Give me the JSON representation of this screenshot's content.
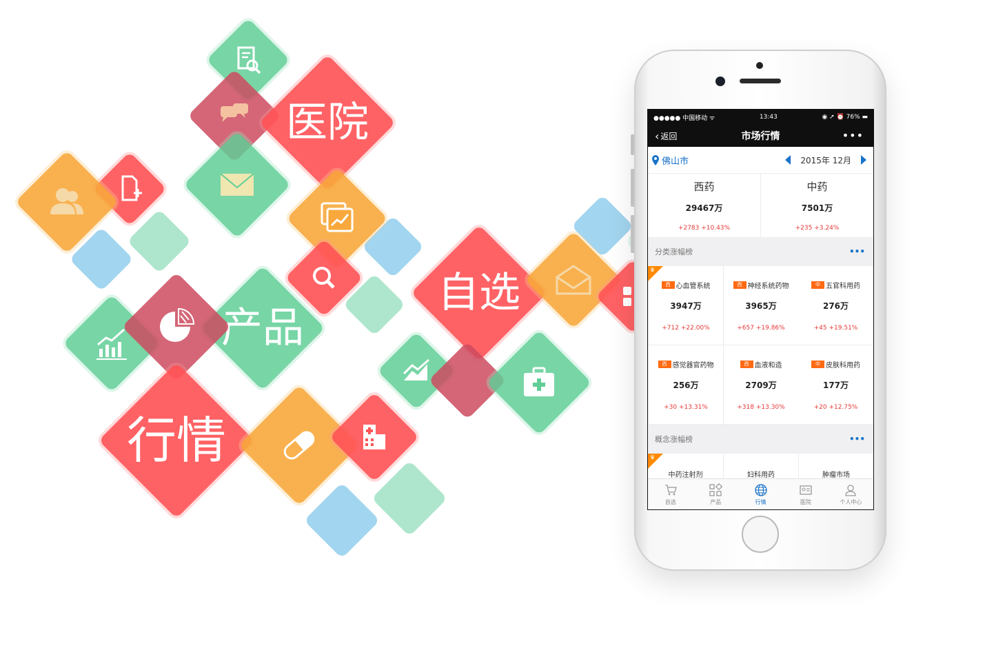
{
  "tiles": {
    "hospital": "医院",
    "product": "产品",
    "favorites": "自选",
    "market": "行情"
  },
  "statusbar": {
    "carrier": "●●●●● 中国移动 ᯤ",
    "time": "13:43",
    "battery": "◉ ➚ ⏰ 76% ▬"
  },
  "navbar": {
    "back_label": "返回",
    "title": "市场行情",
    "more": "•••"
  },
  "citybar": {
    "city": "佛山市",
    "date": "2015年 12月"
  },
  "summary": [
    {
      "name": "西药",
      "value": "29467万",
      "change": "+2783  +10.43%"
    },
    {
      "name": "中药",
      "value": "7501万",
      "change": "+235  +3.24%"
    }
  ],
  "category_section": {
    "title": "分类涨幅榜",
    "more": "•••"
  },
  "category_items": [
    {
      "tag": "西",
      "name": "心血管系统",
      "value": "3947万",
      "change": "+712  +22.00%"
    },
    {
      "tag": "西",
      "name": "神经系统药物",
      "value": "3965万",
      "change": "+657  +19.86%"
    },
    {
      "tag": "中",
      "name": "五官科用药",
      "value": "276万",
      "change": "+45  +19.51%"
    },
    {
      "tag": "西",
      "name": "感觉器官药物",
      "value": "256万",
      "change": "+30  +13.31%"
    },
    {
      "tag": "西",
      "name": "血液和造",
      "value": "2709万",
      "change": "+318  +13.30%"
    },
    {
      "tag": "中",
      "name": "皮肤科用药",
      "value": "177万",
      "change": "+20  +12.75%"
    }
  ],
  "concept_section": {
    "title": "概念涨幅榜",
    "more": "•••"
  },
  "concept_items": [
    {
      "name": "中药注射剂"
    },
    {
      "name": "妇科用药"
    },
    {
      "name": "肿瘤市场"
    }
  ],
  "tabbar": [
    {
      "label": "自选",
      "icon": "cart-icon"
    },
    {
      "label": "产品",
      "icon": "grid-icon"
    },
    {
      "label": "行情",
      "icon": "globe-icon",
      "active": true
    },
    {
      "label": "医院",
      "icon": "id-card-icon"
    },
    {
      "label": "个人中心",
      "icon": "user-icon"
    }
  ],
  "colors": {
    "red": "#ff5558",
    "green": "#60ce96",
    "orange": "#f8a83c",
    "blue": "#92ceec",
    "accent": "#1a73c8",
    "change_red": "#e53935"
  }
}
